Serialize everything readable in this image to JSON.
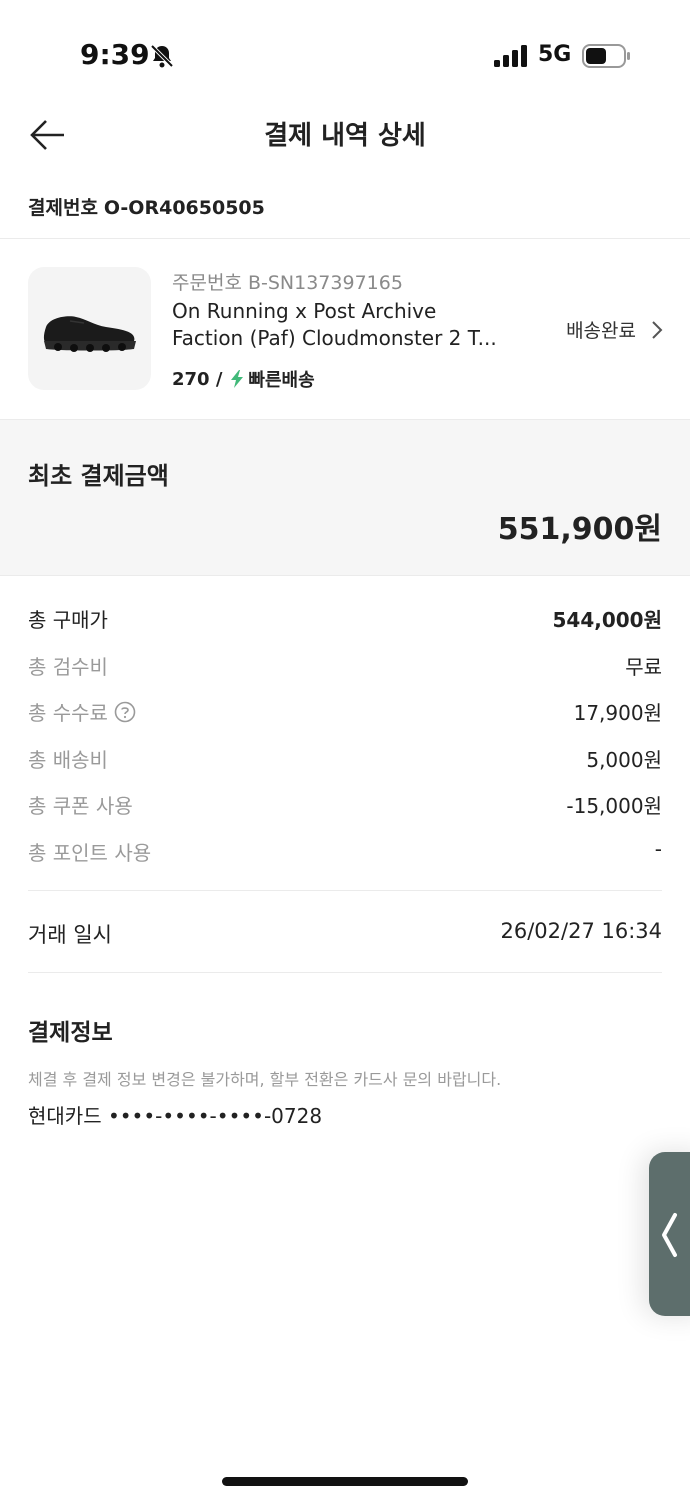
{
  "status_bar": {
    "time": "9:39",
    "network": "5G",
    "icons": [
      "bell-slash-icon",
      "signal-icon",
      "battery-icon"
    ]
  },
  "header": {
    "back_icon": "arrow-left-icon",
    "title": "결제 내역 상세"
  },
  "payment": {
    "number_label": "결제번호",
    "number": "O-OR40650505"
  },
  "product": {
    "order_number": "주문번호 B-SN137397165",
    "name_line1": "On Running x Post Archive",
    "name_line2": "Faction (Paf) Cloudmonster 2 T...",
    "size": "270 /",
    "shipping": "빠른배송",
    "delivery_status": "배송완료",
    "image": "black running shoe"
  },
  "initial_amount": {
    "label": "최초 결제금액",
    "value": "551,900원"
  },
  "breakdown": [
    {
      "label": "총 구매가",
      "value": "544,000원"
    },
    {
      "label": "총 검수비",
      "value": "무료"
    },
    {
      "label": "총 수수료",
      "value": "17,900원"
    },
    {
      "label": "총 배송비",
      "value": "5,000원"
    },
    {
      "label": "총 쿠폰 사용",
      "value": "-15,000원"
    },
    {
      "label": "총 포인트 사용",
      "value": "-"
    }
  ],
  "transaction": {
    "label": "거래 일시",
    "value": "26/02/27 16:34"
  },
  "payment_info": {
    "title": "결제정보",
    "notice": "체결 후 결제 정보 변경은 불가하며, 할부 전환은 카드사 문의 바랍니다.",
    "card": "현대카드 ••••-••••-••••-0728"
  },
  "colors": {
    "accent_green": "#41b979",
    "text_primary": "#222222",
    "text_secondary": "#9a9a9a",
    "section_bg": "#f6f6f6",
    "side_tab": "#5d6e6c"
  }
}
